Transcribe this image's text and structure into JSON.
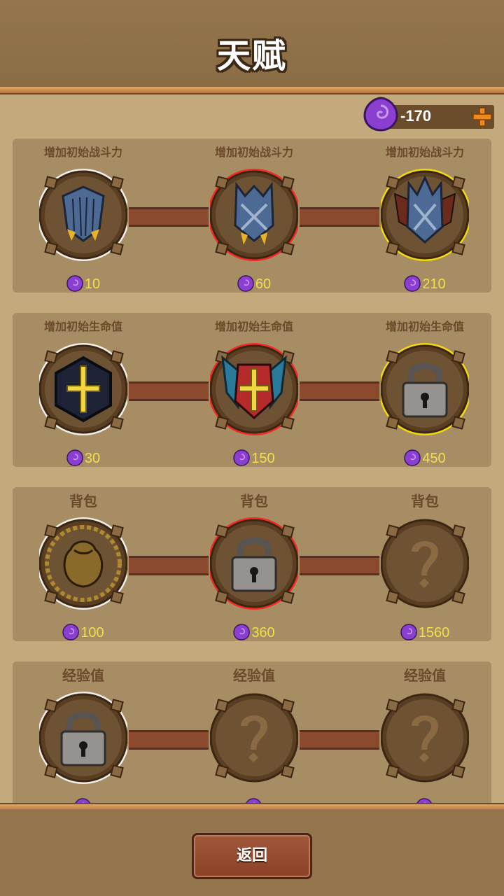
{
  "header": {
    "title": "天赋"
  },
  "currency": {
    "amount": "-170",
    "icon": "purple-gem-icon",
    "add_icon": "plus-icon"
  },
  "rows": [
    {
      "nodes": [
        {
          "label": "增加初始战斗力",
          "cost": "10",
          "state": "unlocked",
          "glow": "white",
          "icon": "shield-icon"
        },
        {
          "label": "增加初始战斗力",
          "cost": "60",
          "state": "unlocked",
          "glow": "red",
          "icon": "spiked-shield-icon"
        },
        {
          "label": "增加初始战斗力",
          "cost": "210",
          "state": "unlocked",
          "glow": "yellow",
          "icon": "winged-shield-icon"
        }
      ]
    },
    {
      "nodes": [
        {
          "label": "增加初始生命值",
          "cost": "30",
          "state": "unlocked",
          "glow": "white",
          "icon": "cross-emblem-icon"
        },
        {
          "label": "增加初始生命值",
          "cost": "150",
          "state": "unlocked",
          "glow": "red",
          "icon": "winged-cross-icon"
        },
        {
          "label": "增加初始生命值",
          "cost": "450",
          "state": "locked",
          "glow": "yellow",
          "icon": "lock-icon"
        }
      ]
    },
    {
      "nodes": [
        {
          "label": "背包",
          "cost": "100",
          "state": "unlocked",
          "glow": "white",
          "icon": "sack-icon"
        },
        {
          "label": "背包",
          "cost": "360",
          "state": "locked",
          "glow": "red",
          "icon": "lock-icon"
        },
        {
          "label": "背包",
          "cost": "1560",
          "state": "unknown",
          "glow": "none",
          "icon": "question-mark-icon"
        }
      ]
    },
    {
      "nodes": [
        {
          "label": "经验值",
          "cost": "",
          "state": "locked",
          "glow": "white",
          "icon": "lock-icon"
        },
        {
          "label": "经验值",
          "cost": "",
          "state": "unknown",
          "glow": "none",
          "icon": "question-mark-icon"
        },
        {
          "label": "经验值",
          "cost": "",
          "state": "unknown",
          "glow": "none",
          "icon": "question-mark-icon"
        }
      ]
    }
  ],
  "footer": {
    "back_label": "返回"
  },
  "colors": {
    "gem": "#8a3fd0",
    "cost_text": "#f3df4a",
    "panel": "#a68d64",
    "connector": "#8b4a2e"
  }
}
